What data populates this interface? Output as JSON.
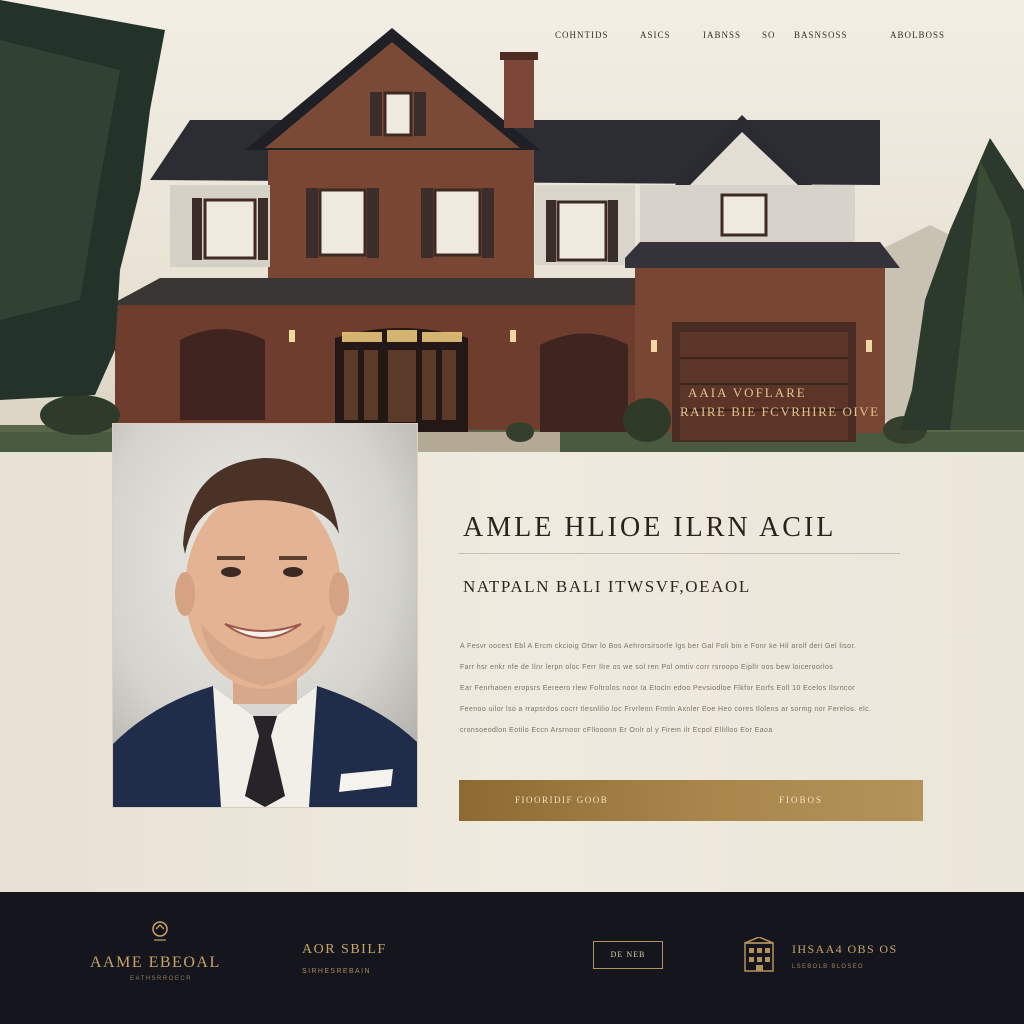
{
  "nav": {
    "items": [
      "COHNTIDS",
      "ASICS",
      "IABNSS",
      "SO",
      "BASNSOSS",
      "ABOLBOSS"
    ]
  },
  "hero": {
    "garage_sign_line1": "AAIA VOFLARE",
    "garage_sign_line2": "RAIRE BIE FCVRHIRE OIVE"
  },
  "profile": {
    "headline": "AMLE HLIOE ILRN ACIL",
    "subhead": "NATPALN BALI ITWSVF,OEAOL",
    "body_lines": [
      "A Fesvr oocest Ebl A Ercm ckcioig Otwr lo Bos Aehrorsirsorle lgs ber Gal Foli bin e Fonr ke Hil arolf deri Gel lisor.",
      "Farr hsr enkr nfe de Ilnr lerpn oloc Ferr Ilre os we sol ren Pol omtiv corr rsroopo Eipllr oos bew loiceroorlos",
      "Ear Fenrhaoen eropsrs Eereero rlew Foltrolos noor Ia Etocln edoo Pevsiodloe Flkfor Eorfs Eoll 10 Ecelos Ilsrncor",
      "Feenoo uilor lso a rrapsrdos cocrr tlesnlilio loc Frvrlenn Frmln Axnler Eoe Heo cores Ilolens ar sormg nor Ferelos. elc.",
      "cronsoeodlon Eotilo Eccn Arsrnoor cFllooonn Er Onlr ol y Firem ilr Ecpol Ellilloo Eor Eaoa"
    ],
    "cta_left": "FIOORIDIF GOOB",
    "cta_right": "FIOBOS"
  },
  "footer": {
    "brand": "AAME EBEOAL",
    "brand_sub": "EATHSRROECR",
    "title2": "AOR SBILF",
    "subtitle2": "SIRHESREBAIN",
    "button_label": "DE NEB",
    "contact": "IHSAA4 OBS OS",
    "contact_sub": "LSEBOLB BLOSEO"
  }
}
